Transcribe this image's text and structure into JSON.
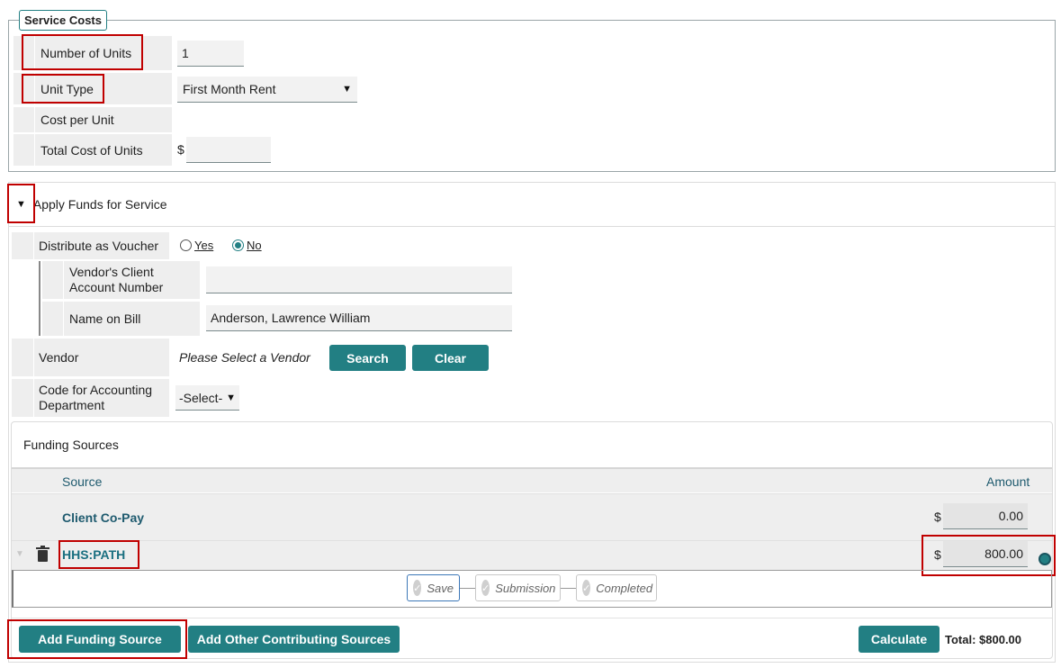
{
  "service_costs": {
    "legend": "Service Costs",
    "number_of_units_label": "Number of Units",
    "number_of_units_value": "1",
    "unit_type_label": "Unit Type",
    "unit_type_value": "First Month Rent",
    "cost_per_unit_label": "Cost per Unit",
    "total_cost_label": "Total Cost of Units",
    "currency_symbol": "$",
    "total_cost_value": ""
  },
  "apply_funds": {
    "title": "Apply Funds for Service",
    "voucher_label": "Distribute as Voucher",
    "voucher_yes": "Yes",
    "voucher_no": "No",
    "vendor_account_label": "Vendor's Client Account Number",
    "vendor_account_value": "",
    "name_on_bill_label": "Name on Bill",
    "name_on_bill_value": "Anderson, Lawrence William",
    "vendor_label": "Vendor",
    "vendor_placeholder": "Please Select a Vendor",
    "search_button": "Search",
    "clear_button": "Clear",
    "accounting_code_label": "Code for Accounting Department",
    "accounting_code_value": "-Select-"
  },
  "funding_sources": {
    "title": "Funding Sources",
    "col_source": "Source",
    "col_amount": "Amount",
    "rows": [
      {
        "source": "Client Co-Pay",
        "currency": "$",
        "amount": "0.00"
      },
      {
        "source": "HHS:PATH",
        "currency": "$",
        "amount": "800.00"
      }
    ],
    "steps": [
      "Save",
      "Submission",
      "Completed"
    ]
  },
  "footer": {
    "add_funding_source": "Add Funding Source",
    "add_other_sources": "Add Other Contributing Sources",
    "calculate": "Calculate",
    "total": "Total: $800.00"
  },
  "colors": {
    "accent": "#227f83",
    "highlight": "#c00000",
    "source_text": "#1e5a6e"
  }
}
